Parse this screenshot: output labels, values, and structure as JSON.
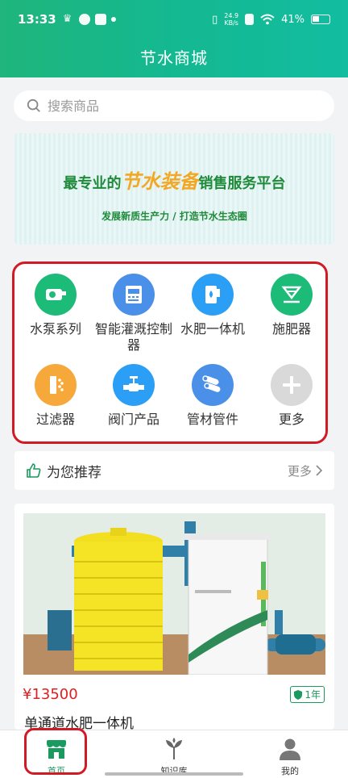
{
  "status": {
    "time": "13:33",
    "net_speed": "24.9",
    "net_unit": "KB/s",
    "battery": "41%"
  },
  "header": {
    "title": "节水商城"
  },
  "search": {
    "placeholder": "搜索商品"
  },
  "banner": {
    "line1_a": "最专业的",
    "line1_b": "节水装备",
    "line1_c": "销售服务平台",
    "line2": "发展新质生产力 / 打造节水生态圈"
  },
  "categories": [
    {
      "label": "水泵系列",
      "icon": "water-pump-icon",
      "color": "#1dbb78"
    },
    {
      "label": "智能灌溉控制器",
      "icon": "irrigation-controller-icon",
      "color": "#4a8fe8"
    },
    {
      "label": "水肥一体机",
      "icon": "fertigation-machine-icon",
      "color": "#2a9ff5"
    },
    {
      "label": "施肥器",
      "icon": "fertilizer-applicator-icon",
      "color": "#1dbb78"
    },
    {
      "label": "过滤器",
      "icon": "filter-icon",
      "color": "#f7a83a"
    },
    {
      "label": "阀门产品",
      "icon": "valve-icon",
      "color": "#2a9ff5"
    },
    {
      "label": "管材管件",
      "icon": "pipe-icon",
      "color": "#4a8fe8"
    },
    {
      "label": "更多",
      "icon": "plus-icon",
      "color": "#d9d9d9"
    }
  ],
  "recommend": {
    "title": "为您推荐",
    "more": "更多"
  },
  "product": {
    "price": "¥13500",
    "warranty": "1年",
    "name": "单通道水肥一体机"
  },
  "tabs": [
    {
      "label": "首页",
      "icon": "home-store-icon"
    },
    {
      "label": "知识库",
      "icon": "knowledge-plant-icon"
    },
    {
      "label": "我的",
      "icon": "user-icon"
    }
  ]
}
